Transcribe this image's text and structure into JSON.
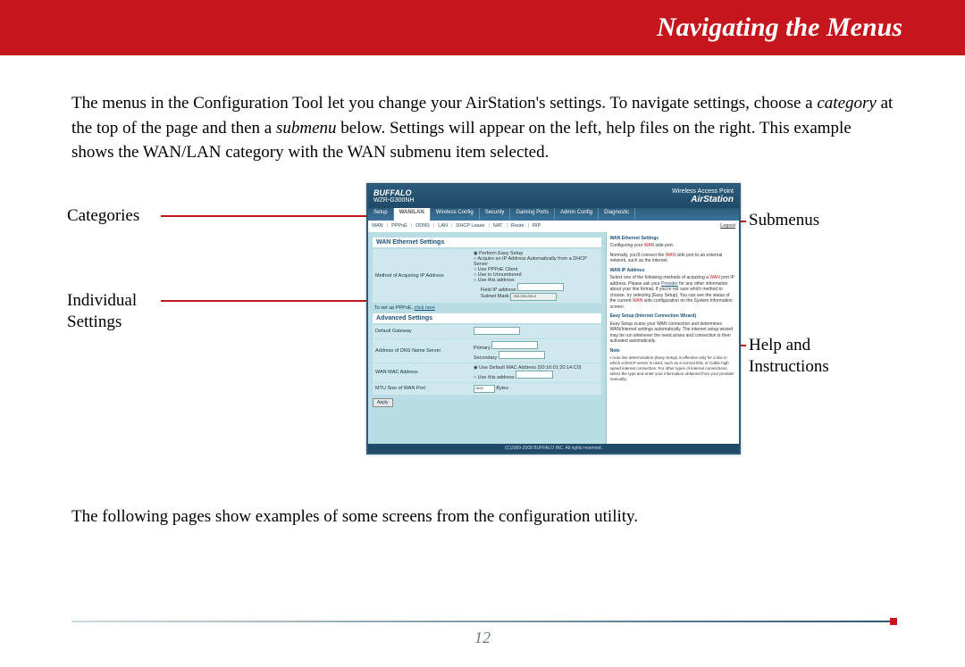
{
  "header": {
    "title": "Navigating the Menus"
  },
  "paragraph1": {
    "t1": "The menus in the Configuration Tool let you change your AirStation's settings. To navigate settings, choose a ",
    "i1": "category",
    "t2": " at the top of the page and then a ",
    "i2": "submenu",
    "t3": " below.  Settings will appear on the left, help files on the right.  This example shows the WAN/LAN category with the WAN submenu item selected."
  },
  "labels": {
    "categories": "Categories",
    "submenus": "Submenus",
    "individual": "Individual Settings",
    "help": "Help and Instructions"
  },
  "shot": {
    "brand": "BUFFALO",
    "model": "WZR-G300NH",
    "air1": "Wireless Access Point",
    "air2": "AirStation",
    "tabs": [
      "Setup",
      "WAN/LAN",
      "Wireless Config",
      "Security",
      "Gaming Ports",
      "Admin Config",
      "Diagnostic"
    ],
    "sub": [
      "WAN",
      "PPPoE",
      "DDNS",
      "LAN",
      "DHCP Lease",
      "NAT",
      "Route",
      "RIP"
    ],
    "logout": "Logout",
    "form_title": "WAN Ethernet Settings",
    "rows": {
      "method": "Method of Acquiring IP Address",
      "opt1": "Perform Easy Setup",
      "opt2": "Acquire an IP Address Automatically from a DHCP Server",
      "opt3": "Use PPPoE Client",
      "opt4": "Use in Unnumbered",
      "opt5": "Use this address",
      "field_ip": "Field IP address",
      "subnet": "Subnet Mask",
      "subnet_val": "255.255.255.0",
      "pppoe": "To set up PPPoE,",
      "clickhere": "click here",
      "adv": "Advanced Settings",
      "gateway": "Default Gateway",
      "dns": "Address of DNS Name Server",
      "dns_p": "Primary",
      "dns_s": "Secondary",
      "mac": "WAN MAC Address",
      "mac_opt1": "Use Default MAC Address (00:16:01:20:14:C0)",
      "mac_opt2": "Use this address",
      "mtu": "MTU Size of WAN Port",
      "mtu_val": "1500",
      "mtu_unit": "Bytes",
      "apply": "Apply"
    },
    "help": {
      "h1": "WAN Ethernet Settings",
      "p1a": "Configuring your ",
      "p1b": " side port.",
      "p2a": "Normally, you'll connect the ",
      "p2b": " side port to an external network, such as the internet.",
      "h2": "WAN IP Address",
      "p3a": "Select one of the following methods of acquiring a ",
      "p3b": " port IP address. Please ask your ",
      "p3link": "Provider",
      "p3c": " for any other information about your line format. If you're not sure which method to choose, try selecting [Easy Setup]. You can see the status of the current ",
      "p3d": " side configuration on the System Information screen.",
      "h3": "Easy Setup (Internet Connection Wizard)",
      "p4": "Easy Setup scans your WAN connection and determines WAN/Internet settings automatically. The internet setup wizard may be run whenever the need arises and connection is then activated automatically.",
      "noteh": "Note",
      "note": "Auto line determination (Easy Setup) is effective only for a line in which a DHCP server is used, such as a normal DSL or Cable high speed internet connection. For other types of internet connections, select the type and enter your information obtained from your provider manually."
    },
    "footer": "(C)2000-2008 BUFFALO INC. All rights reserved."
  },
  "paragraph2": "The following pages show examples of some screens from the configuration utility.",
  "pagenum": "12"
}
